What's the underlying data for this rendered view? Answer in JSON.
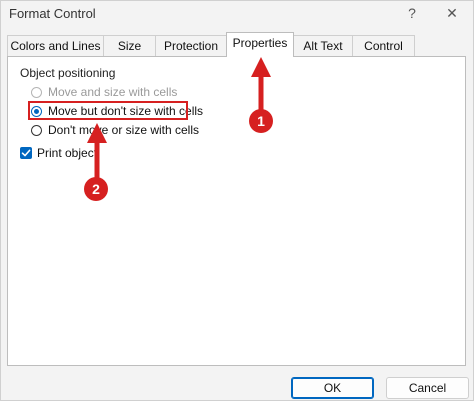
{
  "window": {
    "title": "Format Control",
    "help_label": "?",
    "close_label": "✕"
  },
  "tabs": [
    {
      "label": "Colors and Lines"
    },
    {
      "label": "Size"
    },
    {
      "label": "Protection"
    },
    {
      "label": "Properties",
      "active": true
    },
    {
      "label": "Alt Text"
    },
    {
      "label": "Control"
    }
  ],
  "properties": {
    "group_label": "Object positioning",
    "options": [
      {
        "label": "Move and size with cells",
        "enabled": false,
        "selected": false
      },
      {
        "label": "Move but don't size with cells",
        "enabled": true,
        "selected": true
      },
      {
        "label": "Don't move or size with cells",
        "enabled": true,
        "selected": false
      }
    ],
    "print_object": {
      "label": "Print object",
      "checked": true
    }
  },
  "annotations": {
    "badge_1": "1",
    "badge_2": "2",
    "accent_color": "#d62020"
  },
  "footer": {
    "ok_label": "OK",
    "cancel_label": "Cancel"
  },
  "colors": {
    "accent": "#0067c0",
    "annotation": "#d62020"
  }
}
